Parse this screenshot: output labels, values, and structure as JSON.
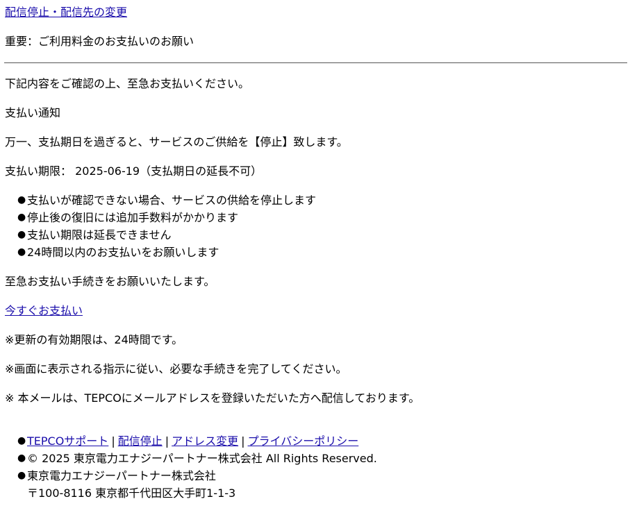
{
  "header": {
    "unsubscribe_link": "配信停止・配信先の変更",
    "subject": "重要：ご利用料金のお支払いのお願い"
  },
  "body": {
    "intro": "下記内容をご確認の上、至急お支払いください。",
    "notice_title": "支払い通知",
    "warning": "万一、支払期日を過ぎると、サービスのご供給を【停止】致します。",
    "deadline_label": "支払い期限：",
    "deadline_date": "2025-06-19",
    "deadline_note": "（支払期日の延長不可）",
    "points": [
      "支払いが確認できない場合、サービスの供給を停止します",
      "停止後の復旧には追加手数料がかかります",
      "支払い期限は延長できません",
      "24時間以内のお支払いをお願いします"
    ],
    "request": "至急お支払い手続きをお願いいたします。",
    "pay_link": "今すぐお支払い",
    "note1": "※更新の有効期限は、24時間です。",
    "note2": "※画面に表示される指示に従い、必要な手続きを完了してください。",
    "note3": "※ 本メールは、TEPCOにメールアドレスを登録いただいた方へ配信しております。"
  },
  "footer": {
    "links": [
      "TEPCOサポート",
      "配信停止",
      "アドレス変更",
      "プライバシーポリシー"
    ],
    "separator": "|",
    "copyright": "© 2025 東京電力エナジーパートナー株式会社 All Rights Reserved.",
    "company": "東京電力エナジーパートナー株式会社",
    "address": "〒100-8116 東京都千代田区大手町1-1-3"
  },
  "colors": {
    "link": "#1a0dab",
    "text": "#000000",
    "rule": "#555555"
  }
}
